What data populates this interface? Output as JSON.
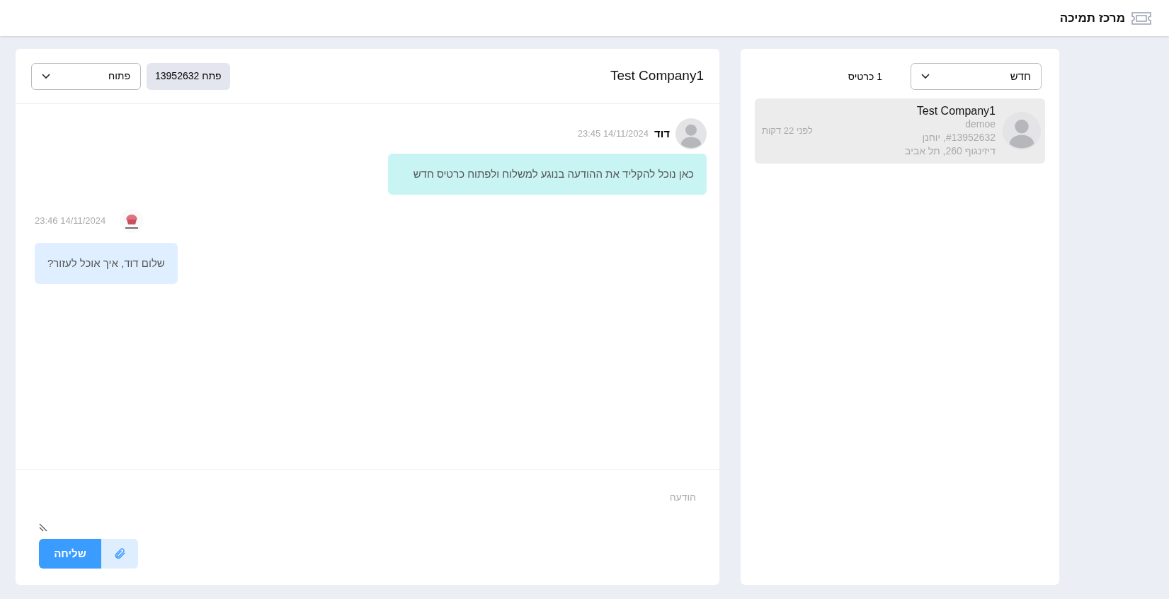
{
  "header": {
    "title": "מרכז תמיכה"
  },
  "ticket_list": {
    "filter": {
      "value": "חדש"
    },
    "count": "1 כרטיס",
    "tickets": [
      {
        "company": "Test Company1",
        "user": "demoe",
        "ticket": "#13952632, יוחנן",
        "address": "דיזינגוף 260, תל אביב",
        "time": "לפני 22 דקות",
        "selected": true
      }
    ]
  },
  "chat": {
    "title": "Test Company1",
    "ticket_badge": "פתח 13952632",
    "status": {
      "value": "פתוח"
    },
    "messages": [
      {
        "kind": "customer",
        "sender": "דוד",
        "time": "14/11/2024 23:45",
        "text": "כאן נוכל להקליד את ההודעה בנוגע למשלוח ולפתוח כרטיס חדש"
      },
      {
        "kind": "agent",
        "time": "14/11/2024 23:46",
        "text": "שלום דוד, איך אוכל לעזור?"
      }
    ],
    "composer": {
      "placeholder": "הודעה",
      "send_button": "שליחה"
    }
  }
}
